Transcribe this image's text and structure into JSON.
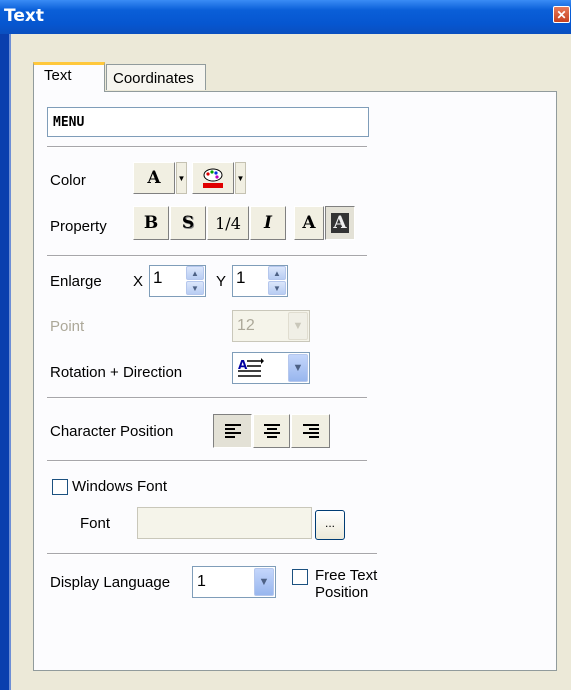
{
  "window": {
    "title": "Text"
  },
  "tabs": [
    {
      "label": "Text"
    },
    {
      "label": "Coordinates"
    }
  ],
  "text_input": {
    "value": "MENU"
  },
  "color": {
    "label": "Color",
    "font_color_glyph": "A",
    "font_color_icon": "letter-a-font-color-icon",
    "bg_color_icon": "palette-icon",
    "accent_red": "#e00000"
  },
  "property": {
    "label": "Property",
    "bold": "B",
    "shadow": "S",
    "quarter": "1/4",
    "italic": "I",
    "normal": "A",
    "reverse": "A"
  },
  "enlarge": {
    "label": "Enlarge",
    "x_label": "X",
    "x_value": "1",
    "y_label": "Y",
    "y_value": "1"
  },
  "point": {
    "label": "Point",
    "value": "12"
  },
  "rotation": {
    "label": "Rotation + Direction",
    "icon": "text-direction-icon"
  },
  "character_position": {
    "label": "Character Position",
    "icons": [
      "align-left-icon",
      "align-center-icon",
      "align-right-icon"
    ]
  },
  "windows_font": {
    "label": "Windows Font",
    "checked": false
  },
  "font": {
    "label": "Font",
    "value": "",
    "browse_label": "..."
  },
  "display_language": {
    "label": "Display Language",
    "value": "1"
  },
  "free_text": {
    "label_line1": "Free Text",
    "label_line2": "Position",
    "checked": false
  }
}
